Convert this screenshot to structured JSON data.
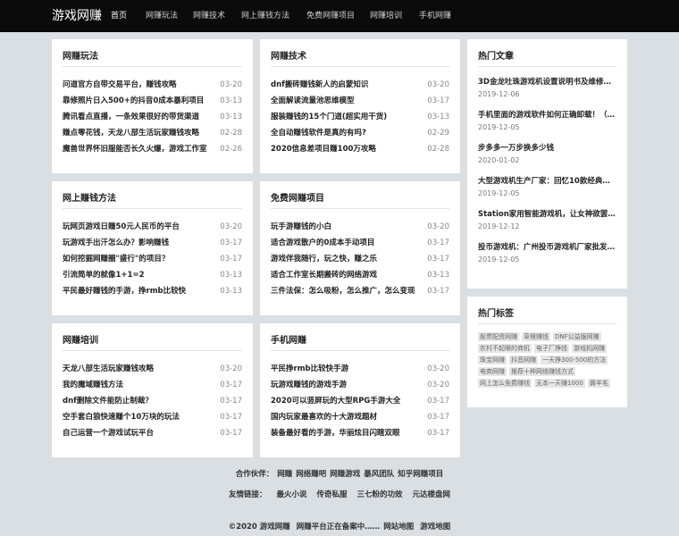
{
  "header": {
    "logo": "游戏网赚",
    "nav": [
      "首页",
      "网赚玩法",
      "网赚技术",
      "网上赚钱方法",
      "免费网赚项目",
      "网赚培训",
      "手机网赚"
    ]
  },
  "sections": [
    {
      "title": "网赚玩法",
      "items": [
        {
          "title": "问道官方自带交易平台，赚钱攻略",
          "date": "03-20"
        },
        {
          "title": "靠修照片日入500+的抖音0成本暴利项目",
          "date": "03-13"
        },
        {
          "title": "腾讯看点直播，一条效果很好的带货渠道",
          "date": "03-13"
        },
        {
          "title": "赚点零花钱，天龙八部生活玩家赚钱攻略",
          "date": "02-28"
        },
        {
          "title": "魔兽世界怀旧服能否长久火爆，游戏工作室",
          "date": "02-26"
        }
      ]
    },
    {
      "title": "网赚技术",
      "items": [
        {
          "title": "dnf搬砖赚钱新人的启蒙知识",
          "date": "03-20"
        },
        {
          "title": "全面解读流量池思维模型",
          "date": "03-17"
        },
        {
          "title": "服装赚钱的15个门道(超实用干货)",
          "date": "03-13"
        },
        {
          "title": "全自动赚钱软件是真的有吗?",
          "date": "02-29"
        },
        {
          "title": "2020信息差项目赚100万攻略",
          "date": "02-28"
        }
      ]
    },
    {
      "title": "网上赚钱方法",
      "items": [
        {
          "title": "玩网页游戏日赚50元人民币的平台",
          "date": "03-20"
        },
        {
          "title": "玩游戏手出汗怎么办？影响赚钱",
          "date": "03-17"
        },
        {
          "title": "如何挖掘网赚圈\"盛行\"的项目？",
          "date": "03-17"
        },
        {
          "title": "引流简单的就像1+1=2",
          "date": "03-13"
        },
        {
          "title": "平民最好赚钱的手游，挣rmb比较快",
          "date": "03-13"
        }
      ]
    },
    {
      "title": "免费网赚项目",
      "items": [
        {
          "title": "玩手游赚钱的小白",
          "date": "03-20"
        },
        {
          "title": "适合游戏散户的0成本手动项目",
          "date": "03-17"
        },
        {
          "title": "游戏伴我随行，玩之快，赚之乐",
          "date": "03-17"
        },
        {
          "title": "适合工作室长期搬砖的网络游戏",
          "date": "03-13"
        },
        {
          "title": "三件法保：怎么吸粉，怎么推广，怎么变现",
          "date": "03-17"
        }
      ]
    },
    {
      "title": "网赚培训",
      "items": [
        {
          "title": "天龙八部生活玩家赚钱攻略",
          "date": "03-20"
        },
        {
          "title": "我的魔域赚钱方法",
          "date": "03-17"
        },
        {
          "title": "dnf删除文件能防止制裁？",
          "date": "03-17"
        },
        {
          "title": "空手套白狼快速赚个10万块的玩法",
          "date": "03-17"
        },
        {
          "title": "自己运营一个游戏试玩平台",
          "date": "03-17"
        }
      ]
    },
    {
      "title": "手机网赚",
      "items": [
        {
          "title": "平民挣rmb比较快手游",
          "date": "03-20"
        },
        {
          "title": "玩游戏赚钱的游戏手游",
          "date": "03-20"
        },
        {
          "title": "2020可以竖屏玩的大型RPG手游大全",
          "date": "03-17"
        },
        {
          "title": "国内玩家最喜欢的十大游戏题材",
          "date": "03-17"
        },
        {
          "title": "装备最好看的手游，华丽炫目闪瞎双眼",
          "date": "03-17"
        }
      ]
    }
  ],
  "hot_articles": {
    "title": "热门文章",
    "items": [
      {
        "title": "3D金龙吐珠游戏机设置说明书及维修方法",
        "date": "2019-12-06"
      },
      {
        "title": "手机里面的游戏软件如何正确卸载！（附教程）",
        "date": "2019-12-05"
      },
      {
        "title": "步多多一万步换多少钱",
        "date": "2020-01-02"
      },
      {
        "title": "大型游戏机生产厂家：回忆10款经典街机游戏",
        "date": "2019-12-05"
      },
      {
        "title": "Station家用智能游戏机，让女神欲罢不能",
        "date": "2019-12-12"
      },
      {
        "title": "投币游戏机：广州投币游戏机厂家批发价格",
        "date": "2019-12-05"
      }
    ]
  },
  "hot_tags": {
    "title": "热门标签",
    "tags": [
      "股票配资网赚",
      "草根赚钱",
      "DNF公益服网赚",
      "农村不起眼的商机",
      "电子厂挣钱",
      "游戏机网赚",
      "珠宝网赚",
      "抖音网赚",
      "一天挣300-500的方法",
      "电商网赚",
      "推荐十种网络赚钱方式",
      "网上怎么免费赚钱",
      "无本一天赚1000",
      "薅羊毛"
    ]
  },
  "footer": {
    "partners_label": "合作伙伴：",
    "partners": [
      "网赚",
      "网络赚吧",
      "网赚游戏",
      "暴风团队",
      "知乎网赚项目"
    ],
    "links_label": "友情链接：",
    "links": [
      "最火小说",
      "传奇私服",
      "三七粉的功效",
      "元达楼盘网"
    ],
    "copyright": "©2020 游戏网赚",
    "icp": "网赚平台正在备案中……",
    "sitemap1": "网站地图",
    "sitemap2": "游戏地图"
  }
}
